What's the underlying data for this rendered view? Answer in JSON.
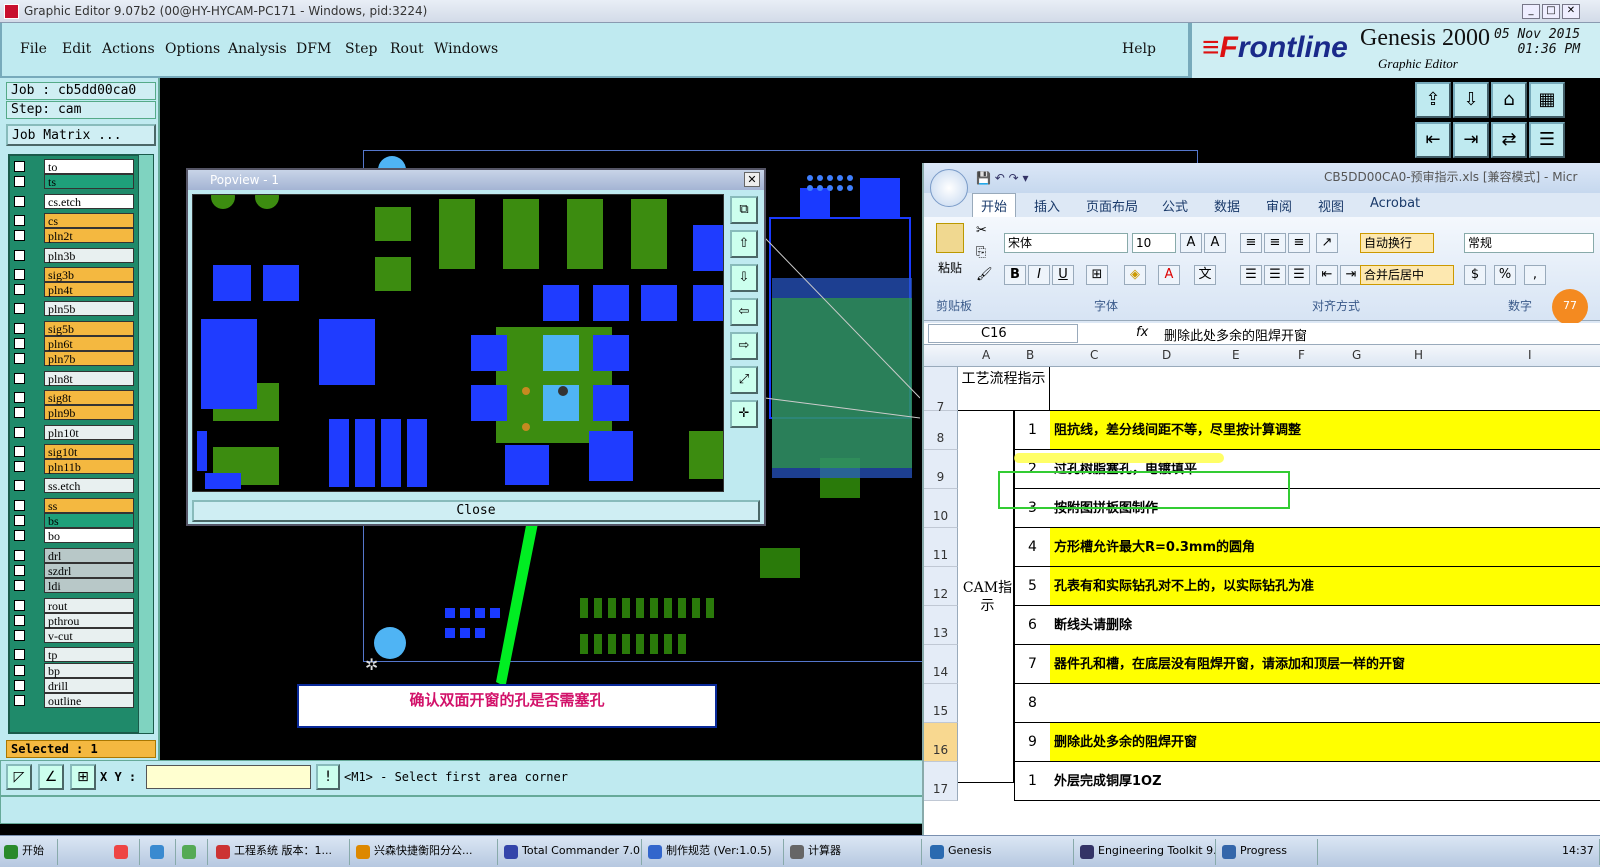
{
  "window": {
    "title": "Graphic Editor 9.07b2 (00@HY-HYCAM-PC171 - Windows, pid:3224)"
  },
  "menu": {
    "items": [
      "File",
      "Edit",
      "Actions",
      "Options",
      "Analysis",
      "DFM",
      "Step",
      "Rout",
      "Windows"
    ],
    "help": "Help"
  },
  "brand": {
    "logo_a": "≡F",
    "logo_b": "rontline",
    "product": "Genesis 2000",
    "module": "Graphic Editor",
    "date": "05 Nov 2015",
    "time": "01:36 PM"
  },
  "job": {
    "job": "Job : cb5dd00ca0",
    "step": "Step: cam",
    "matrix": "Job Matrix ..."
  },
  "layers": [
    {
      "name": "to",
      "bg": "#ffffff"
    },
    {
      "name": "ts",
      "bg": "#1fa07a"
    },
    {
      "name": "cs.etch",
      "bg": "#ffffff"
    },
    {
      "name": "cs",
      "bg": "#f4b840"
    },
    {
      "name": "pln2t",
      "bg": "#f4b840"
    },
    {
      "name": "pln3b",
      "bg": "#e8f0f0"
    },
    {
      "name": "sig3b",
      "bg": "#f4b840"
    },
    {
      "name": "pln4t",
      "bg": "#f4b840"
    },
    {
      "name": "pln5b",
      "bg": "#e8f0f0"
    },
    {
      "name": "sig5b",
      "bg": "#f4b840"
    },
    {
      "name": "pln6t",
      "bg": "#f4b840"
    },
    {
      "name": "pln7b",
      "bg": "#f4b840"
    },
    {
      "name": "pln8t",
      "bg": "#e8f0f0"
    },
    {
      "name": "sig8t",
      "bg": "#f4b840"
    },
    {
      "name": "pln9b",
      "bg": "#f4b840"
    },
    {
      "name": "pln10t",
      "bg": "#e8f0f0"
    },
    {
      "name": "sig10t",
      "bg": "#f4b840"
    },
    {
      "name": "pln11b",
      "bg": "#f4b840"
    },
    {
      "name": "ss.etch",
      "bg": "#e8f0f0"
    },
    {
      "name": "ss",
      "bg": "#f4b840"
    },
    {
      "name": "bs",
      "bg": "#1fa07a"
    },
    {
      "name": "bo",
      "bg": "#ffffff"
    },
    {
      "name": "drl",
      "bg": "#b8c8c8"
    },
    {
      "name": "szdrl",
      "bg": "#b8c8c8"
    },
    {
      "name": "ldi",
      "bg": "#b8c8c8"
    },
    {
      "name": "rout",
      "bg": "#e8f0f0"
    },
    {
      "name": "pthrou",
      "bg": "#e8f0f0"
    },
    {
      "name": "v-cut",
      "bg": "#e8f0f0"
    },
    {
      "name": "tp",
      "bg": "#e8f0f0"
    },
    {
      "name": "bp",
      "bg": "#e8f0f0"
    },
    {
      "name": "drill",
      "bg": "#e8f0f0"
    },
    {
      "name": "outline",
      "bg": "#e8f0f0"
    }
  ],
  "selected": "Selected : 1",
  "bottom": {
    "xy_label": "X Y :",
    "prompt": "<M1> - Select first area corner"
  },
  "popview": {
    "title": "Popview - 1",
    "close": "Close"
  },
  "callout": "确认双面开窗的孔是否需塞孔",
  "excel": {
    "title": "CB5DD00CA0-预审指示.xls  [兼容模式] - Micr",
    "tabs": [
      "开始",
      "插入",
      "页面布局",
      "公式",
      "数据",
      "审阅",
      "视图",
      "Acrobat"
    ],
    "paste": "粘贴",
    "font": "宋体",
    "size": "10",
    "wrap": "自动换行",
    "merge": "合并后居中",
    "numfmt": "常规",
    "groups": [
      "剪贴板",
      "字体",
      "对齐方式",
      "数字"
    ],
    "namebox": "C16",
    "formula": "删除此处多余的阻焊开窗",
    "cols": [
      "A",
      "B",
      "C",
      "D",
      "E",
      "F",
      "G",
      "H",
      "I"
    ],
    "header_a": "工艺流程指示",
    "cam": "CAM指示",
    "rows": [
      {
        "num": "8",
        "b": "1",
        "text": "阻抗线，差分线间距不等，尽里按计算调整",
        "yellow": true
      },
      {
        "num": "9",
        "b": "2",
        "text": "过孔树脂塞孔，电镀填平",
        "yellow": false
      },
      {
        "num": "10",
        "b": "3",
        "text": "按附图拼板图制作",
        "yellow": false
      },
      {
        "num": "11",
        "b": "4",
        "text": "方形槽允许最大R=0.3mm的圆角",
        "yellow": true
      },
      {
        "num": "12",
        "b": "5",
        "text": "孔表有和实际钻孔对不上的，以实际钻孔为准",
        "yellow": true
      },
      {
        "num": "13",
        "b": "6",
        "text": "断线头请删除",
        "yellow": false
      },
      {
        "num": "14",
        "b": "7",
        "text": "器件孔和槽，在底层没有阻焊开窗，请添加和顶层一样的开窗",
        "yellow": true
      },
      {
        "num": "15",
        "b": "8",
        "text": "",
        "yellow": false
      },
      {
        "num": "16",
        "b": "9",
        "text": "删除此处多余的阻焊开窗",
        "yellow": true
      },
      {
        "num": "17",
        "b": "1",
        "text": "外层完成铜厚1OZ",
        "yellow": false
      }
    ],
    "row7": "7"
  },
  "taskbar": [
    "开始",
    "",
    "",
    "",
    "工程系统 版本：1...",
    "兴森快捷衡阳分公...",
    "Total Commander 7.0...",
    "制作规范 (Ver:1.0.5)",
    "计算器",
    "Genesis",
    "Engineering Toolkit 9....",
    "Progress",
    "14:37"
  ]
}
